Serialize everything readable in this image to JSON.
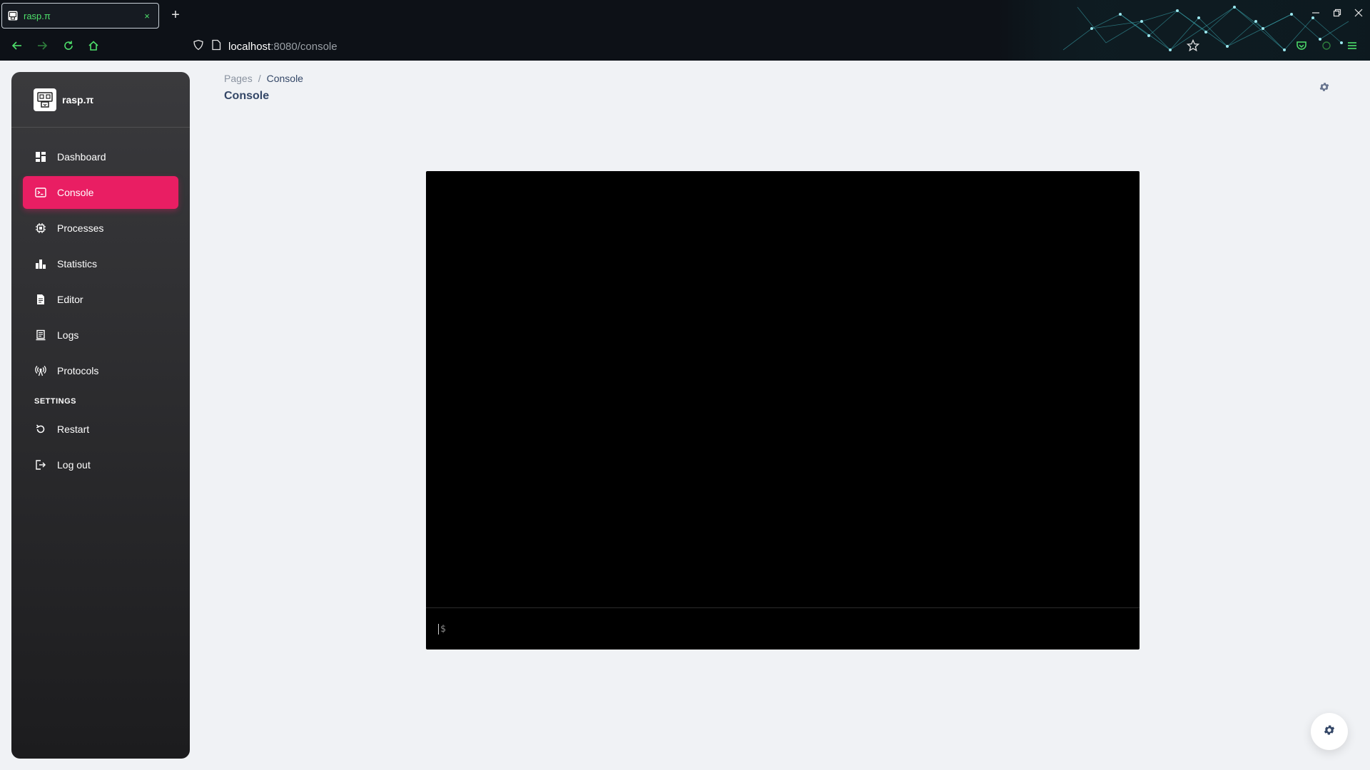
{
  "browser": {
    "tab_title": "rasp.π",
    "tab_close": "×",
    "new_tab": "+",
    "url_host": "localhost",
    "url_path": ":8080/console"
  },
  "sidebar": {
    "brand": "rasp.π",
    "items": [
      {
        "label": "Dashboard",
        "icon": "dashboard-icon"
      },
      {
        "label": "Console",
        "icon": "terminal-icon",
        "active": true
      },
      {
        "label": "Processes",
        "icon": "chip-icon"
      },
      {
        "label": "Statistics",
        "icon": "bar-chart-icon"
      },
      {
        "label": "Editor",
        "icon": "document-icon"
      },
      {
        "label": "Logs",
        "icon": "logs-icon"
      },
      {
        "label": "Protocols",
        "icon": "broadcast-icon"
      }
    ],
    "settings_heading": "SETTINGS",
    "settings_items": [
      {
        "label": "Restart",
        "icon": "restart-icon"
      },
      {
        "label": "Log out",
        "icon": "logout-icon"
      }
    ]
  },
  "header": {
    "breadcrumb_root": "Pages",
    "breadcrumb_sep": "/",
    "breadcrumb_current": "Console",
    "title": "Console"
  },
  "console": {
    "output": "",
    "input_placeholder": "$"
  },
  "colors": {
    "accent": "#e91e63",
    "tab_text": "#4ee06b",
    "sidebar_top": "#3a3a3d",
    "sidebar_bottom": "#1c1c1e",
    "page_bg": "#f0f2f5",
    "console_bg": "#000000"
  }
}
